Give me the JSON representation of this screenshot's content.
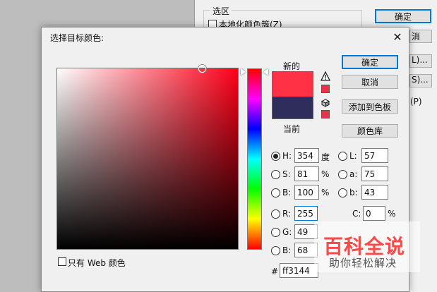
{
  "background_window": {
    "group_title": "选区",
    "localized_check_label": "本地化颜色簇(Z)",
    "ok_label": "确定",
    "edge_labels": [
      "消",
      "L)...",
      "S)...",
      "(P)"
    ]
  },
  "dialog": {
    "title": "选择目标颜色:",
    "new_label": "新的",
    "current_label": "当前",
    "new_color": "#ff3144",
    "current_color": "#2f2d5c",
    "buttons": {
      "ok": "确定",
      "cancel": "取消",
      "add_to_swatches": "添加到色板",
      "color_libraries": "颜色库"
    },
    "hsb": {
      "h": {
        "label": "H:",
        "value": "354",
        "unit": "度"
      },
      "s": {
        "label": "S:",
        "value": "81",
        "unit": "%"
      },
      "b": {
        "label": "B:",
        "value": "100",
        "unit": "%"
      }
    },
    "rgb": {
      "r": {
        "label": "R:",
        "value": "255"
      },
      "g": {
        "label": "G:",
        "value": "49"
      },
      "b": {
        "label": "B:",
        "value": "68"
      }
    },
    "lab": {
      "l": {
        "label": "L:",
        "value": "57"
      },
      "a": {
        "label": "a:",
        "value": "75"
      },
      "b": {
        "label": "b:",
        "value": "43"
      }
    },
    "cmyk": {
      "c": {
        "label": "C:",
        "value": "0",
        "unit": "%"
      }
    },
    "hex": {
      "label": "#",
      "value": "ff3144"
    },
    "web_only_label": "只有 Web 颜色",
    "selected_mode": "H"
  },
  "watermark": {
    "main": "百科全说",
    "sub": "助你轻松解决"
  }
}
